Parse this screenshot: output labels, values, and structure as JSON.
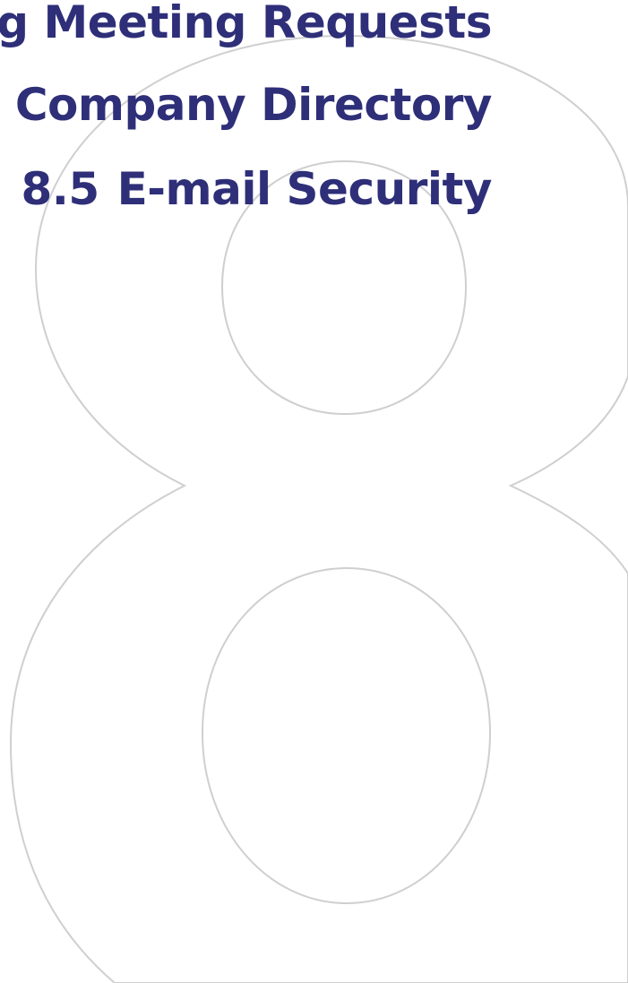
{
  "chapter": {
    "numeral": "8",
    "sections": [
      {
        "text": "ng Meeting Requests"
      },
      {
        "text": "e Company Directory"
      },
      {
        "number": "8.5",
        "title": "E-mail Security"
      }
    ]
  },
  "colors": {
    "heading": "#2e2f78",
    "numeral_outline": "#cfcfcf"
  }
}
